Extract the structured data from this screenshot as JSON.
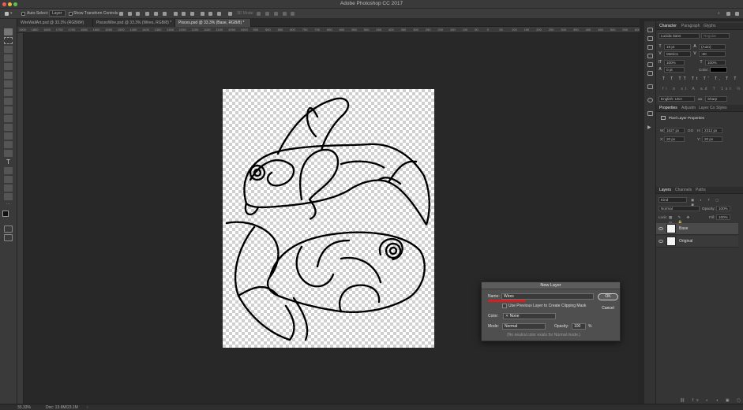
{
  "window": {
    "title": "Adobe Photoshop CC 2017"
  },
  "options_bar": {
    "auto_select_label": "Auto-Select:",
    "auto_select_value": "Layer",
    "transform_label": "Show Transform Controls",
    "mode_3d": "3D Mode:"
  },
  "tabs": [
    {
      "label": "WireWallArt.psd @ 33.3% (RGB/8#)"
    },
    {
      "label": "PiscesWire.psd @ 33.3% (Wires, RGB/8) *"
    },
    {
      "label": "Pisces.psd @ 33.3% (Base, RGB/8) *"
    }
  ],
  "ruler_ticks": [
    "1900",
    "1850",
    "1800",
    "1750",
    "1700",
    "1650",
    "1600",
    "1550",
    "1500",
    "1450",
    "1400",
    "1350",
    "1300",
    "1250",
    "1200",
    "1150",
    "1100",
    "1050",
    "1000",
    "950",
    "900",
    "850",
    "800",
    "750",
    "700",
    "650",
    "600",
    "550",
    "500",
    "450",
    "400",
    "350",
    "300",
    "250",
    "200",
    "150",
    "100",
    "50",
    "0",
    "50",
    "100",
    "150",
    "200",
    "250",
    "300",
    "350",
    "400",
    "450",
    "500",
    "550",
    "600",
    "650",
    "700",
    "750",
    "800",
    "850",
    "900",
    "950",
    "1000",
    "1050",
    "1100",
    "1150",
    "1200",
    "1250",
    "1300",
    "1350",
    "1400",
    "1450",
    "1500",
    "1550",
    "1600",
    "1650",
    "1700",
    "1750",
    "1800",
    "1850",
    "1900",
    "1950",
    "2000",
    "2050",
    "2100",
    "2150",
    "2200",
    "2250",
    "2300",
    "2350",
    "2400",
    "2450",
    "2500",
    "2550",
    "2600",
    "2650",
    "2700",
    "2750",
    "2800",
    "2850",
    "2900",
    "2950",
    "3000",
    "3050",
    "3100",
    "3150",
    "3200",
    "3250",
    "3300",
    "3350",
    "3400",
    "3450",
    "3500",
    "3550",
    "3600",
    "3650",
    "3700",
    "3750",
    "3800",
    "3850"
  ],
  "status": {
    "zoom": "33.33%",
    "doc": "Doc: 13.6M/23.1M"
  },
  "character": {
    "tabs": [
      "Character",
      "Paragraph",
      "Glyphs"
    ],
    "font_family": "Lucida Sans",
    "font_style": "Regular",
    "size": "18 pt",
    "leading": "(Auto)",
    "kerning": "Metrics",
    "tracking": "-60",
    "vscale": "100%",
    "hscale": "100%",
    "baseline": "0 pt",
    "color_label": "Color:",
    "language": "English: USA",
    "aa_label": "aa",
    "aa_value": "Sharp"
  },
  "properties": {
    "tabs": [
      "Properties",
      "Adjustm",
      "Layer Co",
      "Styles"
    ],
    "heading": "Pixel Layer Properties",
    "w_label": "W:",
    "w": "1627 px",
    "go_label": "GO",
    "h_label": "H:",
    "h": "2312 px",
    "x_label": "X:",
    "x": "20 px",
    "y_label": "Y:",
    "y": "20 px"
  },
  "layers": {
    "tabs": [
      "Layers",
      "Channels",
      "Paths"
    ],
    "kind": "Kind",
    "blend": "Normal",
    "opacity_label": "Opacity:",
    "opacity": "100%",
    "lock_label": "Lock:",
    "fill_label": "Fill:",
    "fill": "100%",
    "items": [
      {
        "name": "Base"
      },
      {
        "name": "Original"
      }
    ]
  },
  "dialog": {
    "title": "New Layer",
    "name_label": "Name:",
    "name_value": "Wires",
    "clip_label": "Use Previous Layer to Create Clipping Mask",
    "color_label": "Color:",
    "color_value": "None",
    "mode_label": "Mode:",
    "mode_value": "Normal",
    "opacity_label": "Opacity:",
    "opacity_value": "100",
    "percent": "%",
    "note": "(No neutral color exists for Normal mode.)",
    "ok": "OK",
    "cancel": "Cancel",
    "highlight_color": "#d42020"
  }
}
